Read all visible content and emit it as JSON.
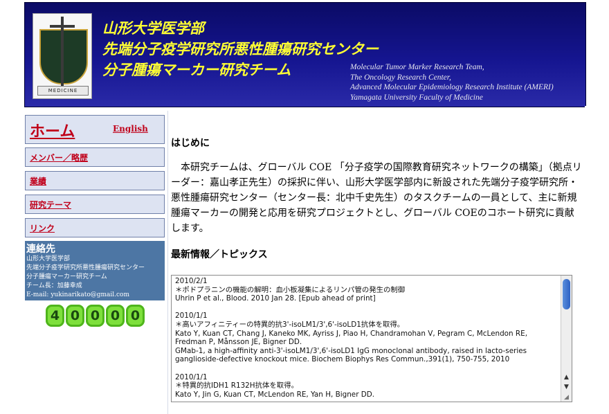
{
  "header": {
    "logo_ribbon": "MEDICINE",
    "title_jp": [
      "山形大学医学部",
      "先端分子疫学研究所悪性腫瘍研究センター",
      "分子腫瘍マーカー研究チーム"
    ],
    "title_en": [
      "Molecular Tumor Marker Research Team,",
      "The Oncology Research Center,",
      "Advanced Molecular Epidemiology Research Institute (AMERI)",
      "Yamagata University Faculty of Medicine"
    ]
  },
  "nav": {
    "home": "ホーム",
    "english": "English",
    "items": [
      "メンバー／略歴",
      "業績",
      "研究テーマ",
      "リンク"
    ]
  },
  "contact": {
    "heading": "連絡先",
    "lines": [
      "山形大学医学部",
      "先端分子疫学研究所悪性腫瘍研究センター",
      "分子腫瘍マーカー研究チーム",
      "チーム長：加藤幸成",
      "E-mail: yukinarikato@gmail.com"
    ]
  },
  "counter": {
    "digits": [
      "4",
      "0",
      "0",
      "0",
      "0"
    ]
  },
  "main": {
    "intro_heading": "はじめに",
    "intro_text": "本研究チームは、グローバル COE 「分子疫学の国際教育研究ネットワークの構築」（拠点リーダー：嘉山孝正先生）の採択に伴い、山形大学医学部内に新設された先端分子疫学研究所・悪性腫瘍研究センター（センター長：北中千史先生）のタスクチームの一員として、主に新規腫瘍マーカーの開発と応用を研究プロジェクトとし、グローバル COEのコホート研究に貢献します。",
    "news_heading": "最新情報／トピックス",
    "news_text": "2010/2/1\n＊ポドプラニンの機能の解明：血小板凝集によるリンパ管の発生の制御\nUhrin P et al., Blood. 2010 Jan 28. [Epub ahead of print]\n\n2010/1/1\n＊高いアフィニティーの特異的抗3'-isoLM1/3',6'-isoLD1抗体を取得。\nKato Y, Kuan CT, Chang J, Kaneko MK, Ayriss J, Piao H, Chandramohan V, Pegram C, McLendon RE, Fredman P, Månsson JE, Bigner DD.\nGMab-1, a high-affinity anti-3'-isoLM1/3',6'-isoLD1 IgG monoclonal antibody, raised in lacto-series ganglioside-defective knockout mice. Biochem Biophys Res Commun.,391(1), 750-755, 2010\n\n2010/1/1\n＊特異的抗IDH1 R132H抗体を取得。\nKato Y, Jin G, Kuan CT, McLendon RE, Yan H, Bigner DD."
  },
  "scroll": {
    "up": "▲",
    "down": "▼",
    "grip": "◢"
  }
}
